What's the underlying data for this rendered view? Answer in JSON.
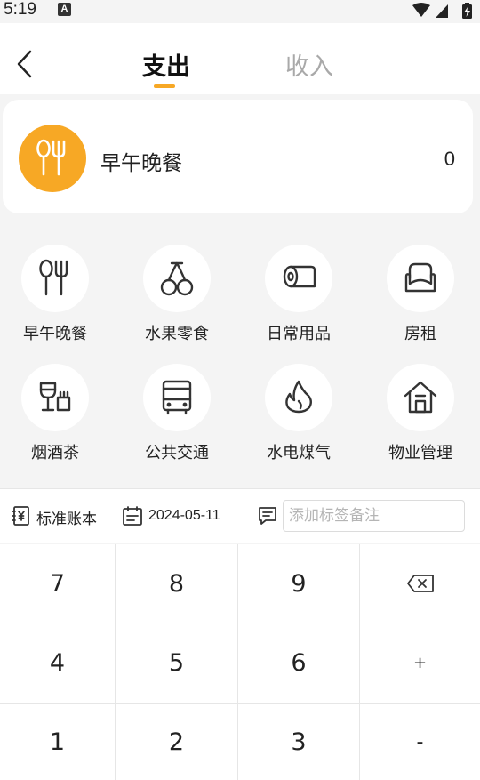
{
  "status_bar": {
    "time": "5:19",
    "notification_letter": "A"
  },
  "header": {
    "tabs": [
      {
        "label": "支出",
        "active": true
      },
      {
        "label": "收入",
        "active": false
      }
    ],
    "accent_color": "#f7a825"
  },
  "selected": {
    "name": "早午晚餐",
    "amount": "0",
    "icon": "fork-spoon-icon"
  },
  "categories": [
    {
      "label": "早午晚餐",
      "icon": "fork-spoon-icon"
    },
    {
      "label": "水果零食",
      "icon": "cherry-icon"
    },
    {
      "label": "日常用品",
      "icon": "tissue-roll-icon"
    },
    {
      "label": "房租",
      "icon": "sofa-icon"
    },
    {
      "label": "烟酒茶",
      "icon": "wine-cigarette-icon"
    },
    {
      "label": "公共交通",
      "icon": "bus-icon"
    },
    {
      "label": "水电煤气",
      "icon": "flame-icon"
    },
    {
      "label": "物业管理",
      "icon": "house-icon"
    }
  ],
  "toolbar": {
    "book_label": "标准账本",
    "date": "2024-05-11",
    "note_placeholder": "添加标签备注",
    "note_value": ""
  },
  "keypad": {
    "keys": [
      [
        "7",
        "8",
        "9",
        "backspace-icon"
      ],
      [
        "4",
        "5",
        "6",
        "+"
      ],
      [
        "1",
        "2",
        "3",
        "-"
      ]
    ]
  }
}
